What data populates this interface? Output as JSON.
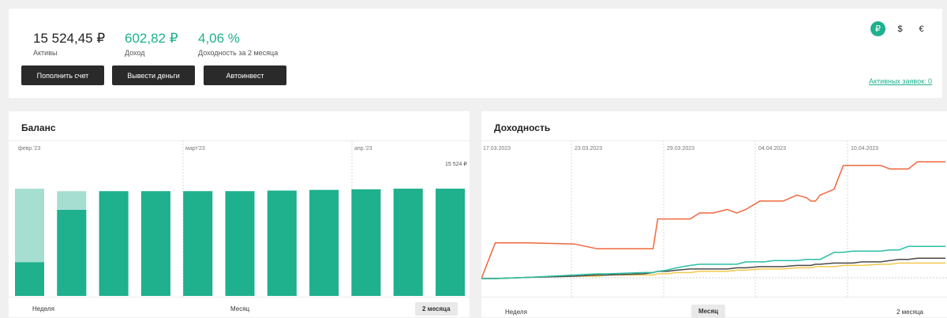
{
  "summary": {
    "assets_value": "15 524,45 ₽",
    "assets_label": "Активы",
    "income_value": "602,82 ₽",
    "income_label": "Доход",
    "yield_value": "4,06 %",
    "yield_label": "Доходность за 2 месяца"
  },
  "buttons": {
    "deposit": "Пополнить счет",
    "withdraw": "Вывести деньги",
    "autoinvest": "Автоинвест"
  },
  "currencies": [
    "₽",
    "$",
    "€"
  ],
  "active_currency": "₽",
  "orders_link": "Активных заявок: 0",
  "balance": {
    "title": "Баланс",
    "months": [
      "февр.'23",
      "март'23",
      "апр.'23"
    ],
    "last_label": "15 524 ₽",
    "periods": [
      "Неделя",
      "Месяц",
      "2 месяца"
    ],
    "active_period": "2 месяца"
  },
  "yield": {
    "title": "Доходность",
    "dates": [
      "17.03.2023",
      "23.03.2023",
      "29.03.2023",
      "04.04.2023",
      "10.04.2023"
    ],
    "periods": [
      "Неделя",
      "Месяц",
      "2 месяца"
    ],
    "active_period": "Месяц"
  },
  "colors": {
    "accent": "#1fb08e",
    "bar_light": "#a6ded1",
    "line_orange": "#f0673d",
    "line_teal": "#2abfa3",
    "line_dark": "#4a4a4a",
    "line_yellow": "#f2c94c"
  },
  "chart_data": [
    {
      "type": "bar",
      "title": "Баланс",
      "unit": "₽",
      "series": [
        {
          "values": [
            0.27,
            0.69,
            0.84,
            0.84,
            0.84,
            0.84,
            0.845,
            0.85,
            0.855,
            0.86,
            0.86
          ]
        },
        {
          "values": [
            0.86,
            0.84,
            0.84,
            0.84,
            0.84,
            0.84,
            0.845,
            0.85,
            0.855,
            0.86,
            0.86
          ]
        }
      ],
      "last_value": 15524
    },
    {
      "type": "line",
      "title": "Доходность",
      "x": [
        0,
        0.03,
        0.1,
        0.2,
        0.25,
        0.27,
        0.35,
        0.37,
        0.38,
        0.4,
        0.42,
        0.45,
        0.47,
        0.5,
        0.53,
        0.55,
        0.57,
        0.6,
        0.61,
        0.63,
        0.65,
        0.68,
        0.7,
        0.71,
        0.72,
        0.73,
        0.76,
        0.78,
        0.8,
        0.82,
        0.86,
        0.88,
        0.9,
        0.92,
        0.94,
        1.0
      ],
      "series": [
        {
          "color": "orange",
          "values": [
            0.0,
            0.3,
            0.3,
            0.29,
            0.25,
            0.25,
            0.25,
            0.25,
            0.5,
            0.5,
            0.5,
            0.5,
            0.55,
            0.55,
            0.58,
            0.55,
            0.58,
            0.65,
            0.65,
            0.65,
            0.65,
            0.7,
            0.68,
            0.65,
            0.65,
            0.7,
            0.75,
            0.95,
            0.95,
            0.95,
            0.95,
            0.92,
            0.92,
            0.92,
            0.98,
            0.98
          ]
        },
        {
          "color": "teal",
          "values": [
            0.0,
            0.0,
            0.01,
            0.03,
            0.04,
            0.04,
            0.05,
            0.05,
            0.06,
            0.07,
            0.09,
            0.11,
            0.12,
            0.12,
            0.12,
            0.12,
            0.14,
            0.14,
            0.14,
            0.15,
            0.15,
            0.15,
            0.16,
            0.16,
            0.16,
            0.16,
            0.22,
            0.22,
            0.23,
            0.23,
            0.23,
            0.24,
            0.24,
            0.27,
            0.27,
            0.27
          ]
        },
        {
          "color": "dark",
          "values": [
            0.0,
            0.0,
            0.01,
            0.02,
            0.03,
            0.03,
            0.04,
            0.05,
            0.06,
            0.06,
            0.07,
            0.08,
            0.08,
            0.08,
            0.08,
            0.09,
            0.09,
            0.1,
            0.1,
            0.1,
            0.1,
            0.11,
            0.11,
            0.11,
            0.12,
            0.12,
            0.13,
            0.13,
            0.13,
            0.14,
            0.14,
            0.15,
            0.16,
            0.16,
            0.17,
            0.17
          ]
        },
        {
          "color": "yellow",
          "values": [
            0.0,
            0.0,
            0.01,
            0.02,
            0.02,
            0.03,
            0.03,
            0.03,
            0.04,
            0.04,
            0.05,
            0.05,
            0.06,
            0.06,
            0.06,
            0.07,
            0.07,
            0.08,
            0.08,
            0.08,
            0.08,
            0.09,
            0.09,
            0.09,
            0.1,
            0.1,
            0.1,
            0.11,
            0.11,
            0.11,
            0.12,
            0.12,
            0.13,
            0.13,
            0.13,
            0.13
          ]
        }
      ]
    }
  ]
}
